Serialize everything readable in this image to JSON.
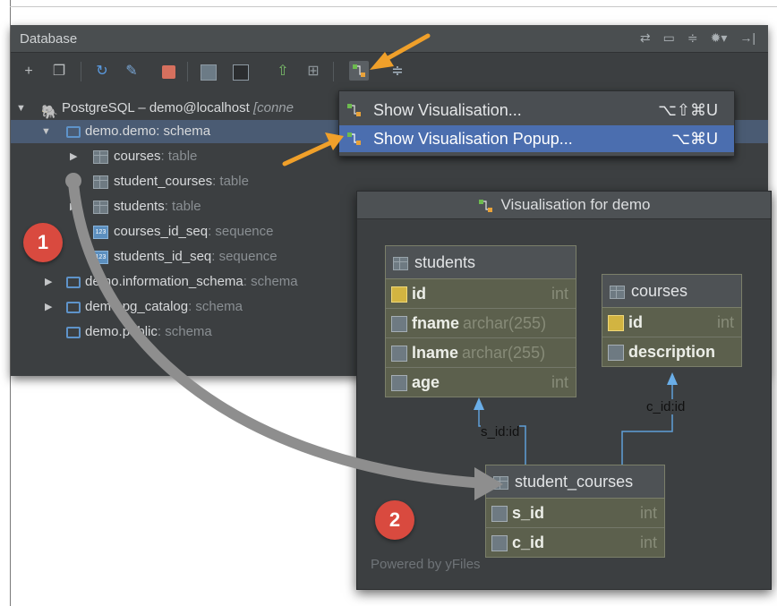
{
  "panel": {
    "title": "Database",
    "header_icons": [
      "sync-icon",
      "sql-console-icon",
      "collapse-icon",
      "gear-icon",
      "hide-icon"
    ],
    "toolbar_icons": [
      "add-icon",
      "copy-icon",
      "refresh-icon",
      "edit-icon",
      "stop-icon",
      "table-icon",
      "sql-icon",
      "ddl-icon",
      "diff-icon",
      "visualisation-icon",
      "collapse-all-icon"
    ]
  },
  "tree": {
    "connection": {
      "name": "PostgreSQL – demo@localhost",
      "suffix": "[conne"
    },
    "schema": {
      "name": "demo.demo",
      "kind": ": schema"
    },
    "items": [
      {
        "name": "courses",
        "kind": ": table"
      },
      {
        "name": "student_courses",
        "kind": ": table"
      },
      {
        "name": "students",
        "kind": ": table"
      },
      {
        "name": "courses_id_seq",
        "kind": ": sequence"
      },
      {
        "name": "students_id_seq",
        "kind": ": sequence"
      }
    ],
    "other_schemas": [
      {
        "name": "demo.information_schema",
        "kind": ": schema"
      },
      {
        "name": "demo.pg_catalog",
        "kind": ": schema"
      },
      {
        "name": "demo.public",
        "kind": ": schema"
      }
    ]
  },
  "menu": {
    "items": [
      {
        "label": "Show Visualisation...",
        "shortcut": "⌥⇧⌘U"
      },
      {
        "label": "Show Visualisation Popup...",
        "shortcut": "⌥⌘U"
      }
    ]
  },
  "visualisation": {
    "title": "Visualisation for demo",
    "powered_by": "Powered by yFiles",
    "students": {
      "name": "students",
      "fields": [
        {
          "name": "id",
          "type": "int",
          "key": true
        },
        {
          "name": "fname",
          "type": "archar(255)"
        },
        {
          "name": "lname",
          "type": "archar(255)"
        },
        {
          "name": "age",
          "type": "int"
        }
      ]
    },
    "courses": {
      "name": "courses",
      "fields": [
        {
          "name": "id",
          "type": "int",
          "key": true
        },
        {
          "name": "description",
          "type": ""
        }
      ]
    },
    "student_courses": {
      "name": "student_courses",
      "fields": [
        {
          "name": "s_id",
          "type": "int"
        },
        {
          "name": "c_id",
          "type": "int"
        }
      ]
    },
    "relations": {
      "students": "s_id:id",
      "courses": "c_id:id"
    }
  },
  "badges": {
    "one": "1",
    "two": "2"
  },
  "colors": {
    "panel": "#3c3f41",
    "selection": "#4a5b73",
    "menu_active": "#4b6eaf",
    "entity": "#5c604d",
    "badge": "#d94a3f",
    "arrow_orange": "#f0a02a"
  }
}
